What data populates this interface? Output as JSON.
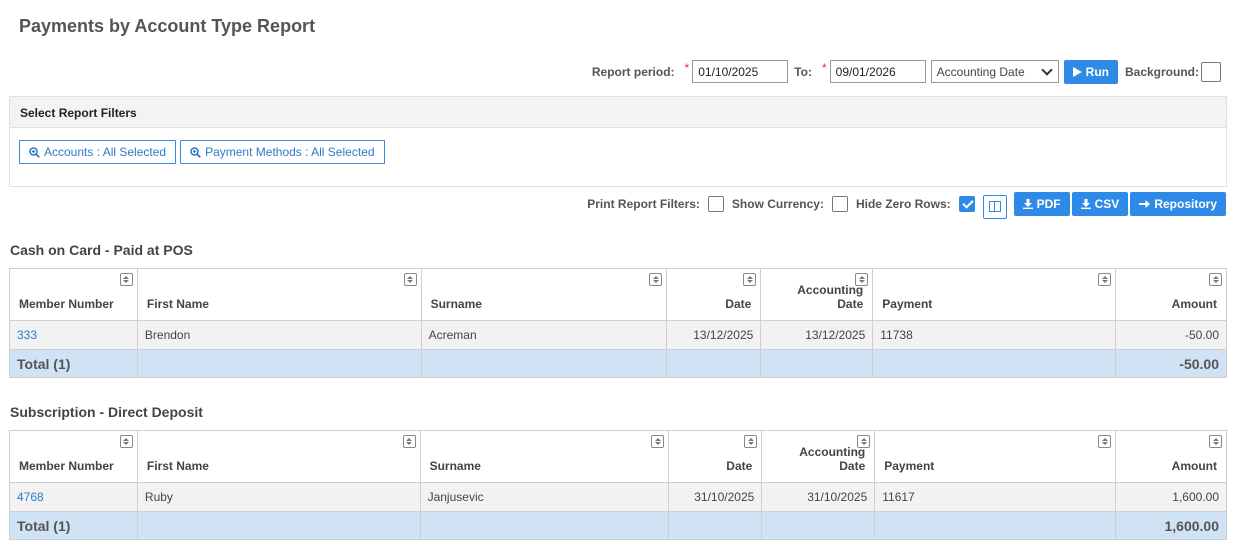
{
  "page": {
    "title": "Payments by Account Type Report"
  },
  "period": {
    "label": "Report period:",
    "required_mark": "*",
    "from_value": "01/10/2025",
    "to_label": "To:",
    "to_value": "09/01/2026",
    "date_type": "Accounting Date",
    "run_label": "Run",
    "background_label": "Background:"
  },
  "filters": {
    "header": "Select Report Filters",
    "accounts_label": "Accounts : All Selected",
    "payment_methods_label": "Payment Methods : All Selected"
  },
  "options": {
    "print_filters_label": "Print Report Filters:",
    "show_currency_label": "Show Currency:",
    "hide_zero_rows_label": "Hide Zero Rows:",
    "pdf_label": "PDF",
    "csv_label": "CSV",
    "repository_label": "Repository"
  },
  "columns": [
    "Member Number",
    "First Name",
    "Surname",
    "Date",
    "Accounting Date",
    "Payment",
    "Amount"
  ],
  "sections": [
    {
      "title": "Cash on Card - Paid at POS",
      "rows": [
        {
          "member": "333",
          "first": "Brendon",
          "surname": "Acreman",
          "date": "13/12/2025",
          "accounting_date": "13/12/2025",
          "payment": "11738",
          "amount": "-50.00"
        }
      ],
      "total_label": "Total (1)",
      "total_amount": "-50.00"
    },
    {
      "title": "Subscription - Direct Deposit",
      "rows": [
        {
          "member": "4768",
          "first": "Ruby",
          "surname": "Janjusevic",
          "date": "31/10/2025",
          "accounting_date": "31/10/2025",
          "payment": "11617",
          "amount": "1,600.00"
        }
      ],
      "total_label": "Total (1)",
      "total_amount": "1,600.00"
    }
  ]
}
